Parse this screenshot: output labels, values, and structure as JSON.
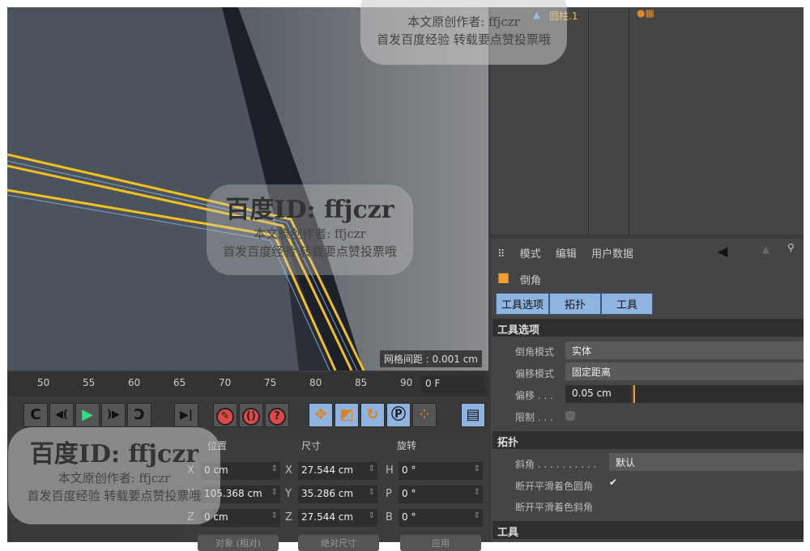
{
  "viewport": {
    "grid_spacing": "网格间距 : 0.001 cm"
  },
  "objects": {
    "name": "圆柱.1"
  },
  "attributes": {
    "menu": [
      "模式",
      "编辑",
      "用户数据"
    ],
    "tool_name": "倒角",
    "tabs": [
      "工具选项",
      "拓扑",
      "工具"
    ],
    "section_tool_options": "工具选项",
    "bevel_mode_label": "倒角模式",
    "bevel_mode_value": "实体",
    "offset_mode_label": "偏移模式",
    "offset_mode_value": "固定距离",
    "offset_label": "偏移 . . .",
    "offset_value": "0.05 cm",
    "limit_label": "限制 . . .",
    "section_topology": "拓扑",
    "miter_label": "斜角 . . . . . . . . . .",
    "miter_value": "默认",
    "break_round_label": "断开平滑着色圆角",
    "break_miter_label": "断开平滑着色斜角",
    "section_tool": "工具"
  },
  "timeline": {
    "ticks": [
      "50",
      "55",
      "60",
      "65",
      "70",
      "75",
      "80",
      "85",
      "90"
    ],
    "frame": "0 F"
  },
  "coords": {
    "headers": [
      "位置",
      "尺寸",
      "旋转"
    ],
    "pos": [
      {
        "axis": "X",
        "value": "0 cm"
      },
      {
        "axis": "Y",
        "value": "105.368 cm"
      },
      {
        "axis": "Z",
        "value": "0 cm"
      }
    ],
    "size": [
      {
        "axis": "X",
        "value": "27.544 cm"
      },
      {
        "axis": "Y",
        "value": "35.286 cm"
      },
      {
        "axis": "Z",
        "value": "27.544 cm"
      }
    ],
    "rot": [
      {
        "axis": "H",
        "value": "0 °"
      },
      {
        "axis": "P",
        "value": "0 °"
      },
      {
        "axis": "B",
        "value": "0 °"
      }
    ],
    "buttons": [
      "对象 (相对)",
      "绝对尺寸",
      "应用"
    ]
  },
  "watermark": {
    "id": "百度ID: ffjczr",
    "author": "本文原创作者: ffjczr",
    "note": "首发百度经验 转载要点赞投票哦"
  }
}
